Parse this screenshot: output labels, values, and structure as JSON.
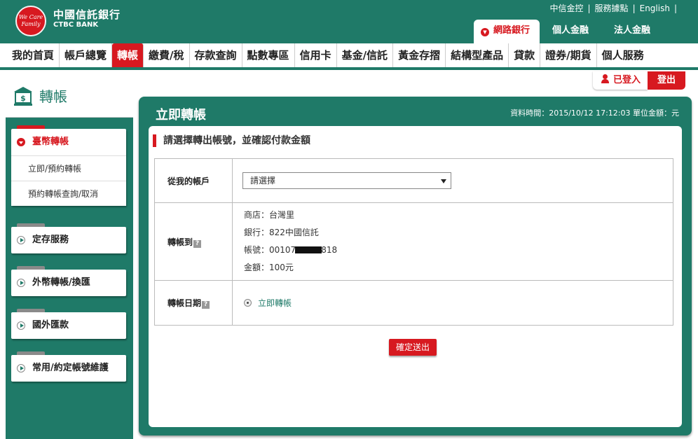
{
  "brand": {
    "logo_text": "We Care Family",
    "name_zh": "中國信託銀行",
    "name_en": "CTBC BANK"
  },
  "toplinks": [
    "中信金控",
    "服務據點",
    "English"
  ],
  "maintabs": [
    "網路銀行",
    "個人金融",
    "法人金融"
  ],
  "menu": [
    "我的首頁",
    "帳戶總覽",
    "轉帳",
    "繳費/稅",
    "存款查詢",
    "點數專區",
    "信用卡",
    "基金/信託",
    "黃金存摺",
    "結構型產品",
    "貸款",
    "證券/期貨",
    "個人服務"
  ],
  "login": {
    "status": "已登入",
    "logout": "登出"
  },
  "sidebar": {
    "title": "轉帳",
    "groups": [
      {
        "label": "臺幣轉帳",
        "items": [
          "立即/預約轉帳",
          "預約轉帳查詢/取消"
        ]
      },
      {
        "label": "定存服務"
      },
      {
        "label": "外幣轉帳/換匯"
      },
      {
        "label": "國外匯款"
      },
      {
        "label": "常用/約定帳號維護"
      }
    ]
  },
  "panel": {
    "title": "立即轉帳",
    "meta": "資料時間：2015/10/12 17:12:03 單位金額：元",
    "subhead": "請選擇轉出帳號，並確認付款金額",
    "from_label": "從我的帳戶",
    "from_select": "請選擇",
    "to_label": "轉帳到",
    "help_glyph": "?",
    "to_info": {
      "shop": "商店：台灣里",
      "bank": "銀行：822中國信託",
      "account_prefix": "帳號：00107",
      "account_suffix": "818",
      "amount": "金額：100元"
    },
    "date_label": "轉帳日期",
    "date_option": "立即轉帳",
    "submit": "確定送出"
  },
  "colors": {
    "brand_green": "#1f7a68",
    "brand_red": "#d71920"
  }
}
